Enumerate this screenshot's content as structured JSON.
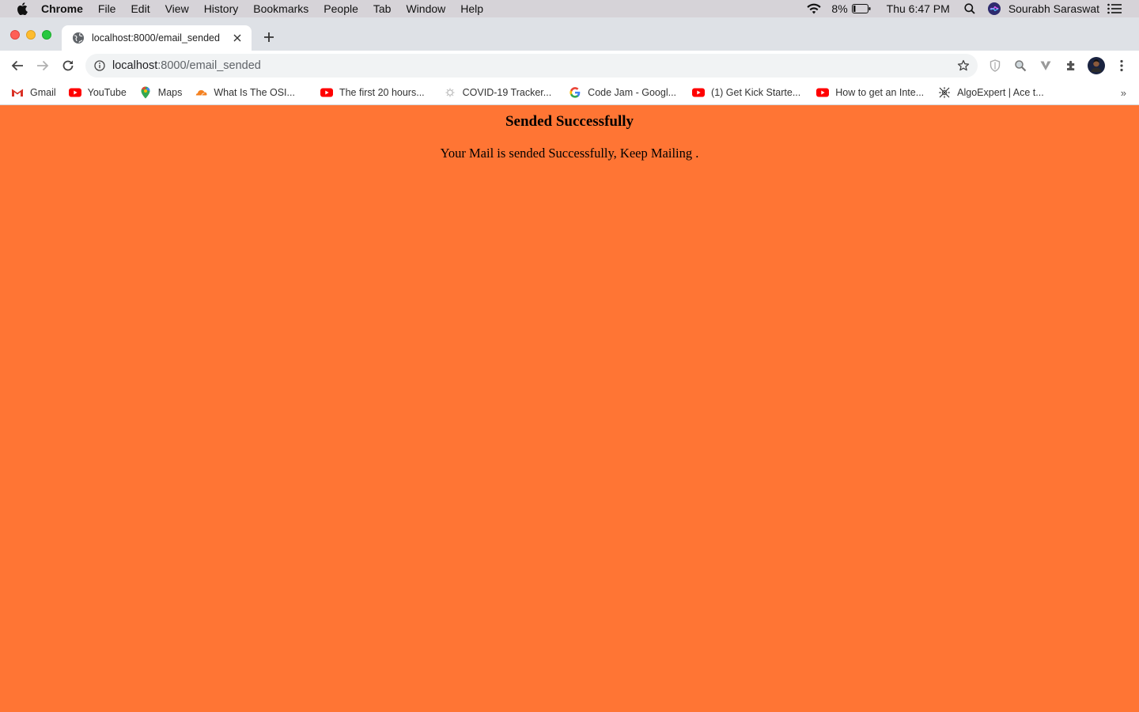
{
  "menubar": {
    "app": "Chrome",
    "items": [
      "File",
      "Edit",
      "View",
      "History",
      "Bookmarks",
      "People",
      "Tab",
      "Window",
      "Help"
    ],
    "battery": "8%",
    "clock": "Thu 6:47 PM",
    "user": "Sourabh Saraswat"
  },
  "tab": {
    "title": "localhost:8000/email_sended"
  },
  "omnibox": {
    "host": "localhost",
    "path": ":8000/email_sended"
  },
  "bookmarks": [
    {
      "label": "Gmail",
      "icon": "gmail-icon"
    },
    {
      "label": "YouTube",
      "icon": "youtube-icon"
    },
    {
      "label": "Maps",
      "icon": "maps-icon"
    },
    {
      "label": "What Is The OSI...",
      "icon": "cloudflare-icon"
    },
    {
      "label": "The first 20 hours...",
      "icon": "youtube-icon"
    },
    {
      "label": "COVID-19 Tracker...",
      "icon": "covid-icon"
    },
    {
      "label": "Code Jam - Googl...",
      "icon": "google-icon"
    },
    {
      "label": "(1) Get Kick Starte...",
      "icon": "youtube-icon"
    },
    {
      "label": "How to get an Inte...",
      "icon": "youtube-icon"
    },
    {
      "label": "AlgoExpert | Ace t...",
      "icon": "algoexpert-icon"
    }
  ],
  "page": {
    "heading": "Sended Successfully",
    "message": "Your Mail is sended Successfully, Keep Mailing ."
  },
  "colors": {
    "page_background": "#ff7534",
    "tabstrip": "#dee1e6",
    "menubar": "#d6d3d8"
  }
}
